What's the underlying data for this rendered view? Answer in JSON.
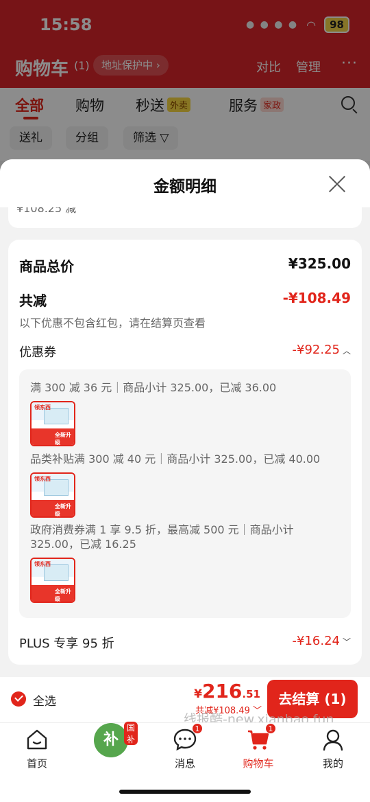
{
  "status_bar": {
    "time": "15:58",
    "battery": "98"
  },
  "header": {
    "title": "购物车",
    "count": "(1)",
    "address_pill": "地址保护中 ›",
    "compare": "对比",
    "manage": "管理",
    "more": "···"
  },
  "tabs": [
    {
      "label": "全部"
    },
    {
      "label": "购物"
    },
    {
      "label": "秒送",
      "badge": "外卖"
    },
    {
      "label": "服务",
      "badge": "家政"
    }
  ],
  "filters": [
    "送礼",
    "分组",
    "筛选 ▽"
  ],
  "sheet": {
    "title": "金额明细",
    "prev_text": "¥108.25    减",
    "goods_total_label": "商品总价",
    "goods_total_value": "¥325.00",
    "discount_label": "共减",
    "discount_value": "-¥108.49",
    "discount_note": "以下优惠不包含红包，请在结算页查看",
    "coupon_label": "优惠券",
    "coupon_value": "-¥92.25",
    "coupon_lines": [
      "满 300 减 36 元｜商品小计 325.00，已减 36.00",
      "品类补贴满 300 减 40 元｜商品小计 325.00，已减 40.00",
      "政府消费券满 1 享 9.5 折，最高减 500 元｜商品小计 325.00，已减 16.25"
    ],
    "thumb_brand": "领东西",
    "thumb_banner": "全新升级",
    "plus_label": "PLUS 专享 95 折",
    "plus_value": "-¥16.24"
  },
  "bottom_bar": {
    "select_all": "全选",
    "price_currency": "¥",
    "price_int": "216",
    "price_dec": ".51",
    "saved": "共减¥108.49 ﹀",
    "checkout": "去结算 (1)"
  },
  "nav": [
    {
      "label": "首页"
    },
    {
      "label": "",
      "tag": "国补",
      "glyph": "补"
    },
    {
      "label": "消息",
      "badge": "1"
    },
    {
      "label": "购物车",
      "badge": "1"
    },
    {
      "label": "我的"
    }
  ],
  "watermark": "线报酷-new.xianbao.fun",
  "colors": {
    "accent": "#e1251b",
    "header_red": "#d9262a",
    "overlay": "rgba(0,0,0,0.45)"
  }
}
